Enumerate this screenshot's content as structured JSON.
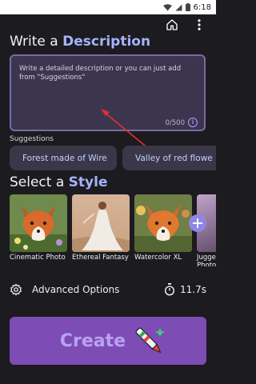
{
  "status_bar": {
    "time": "6:18"
  },
  "description_section": {
    "title_prefix": "Write a",
    "title_accent": "Description"
  },
  "description_input": {
    "placeholder": "Write a detailed description or you can just add from \"Suggestions\"",
    "counter": "0/500",
    "info_glyph": "i"
  },
  "suggestions": {
    "label": "Suggestions",
    "chips": [
      "Forest made of Wire",
      "Valley of red flowe"
    ]
  },
  "style_section": {
    "title_prefix": "Select a",
    "title_accent": "Style"
  },
  "styles": [
    {
      "label": "Cinematic Photo"
    },
    {
      "label": "Ethereal Fantasy"
    },
    {
      "label": "Watercolor XL"
    },
    {
      "label": "Jugge\nPhoto"
    }
  ],
  "advanced": {
    "label": "Advanced Options"
  },
  "timer": {
    "value": "11.7s"
  },
  "create": {
    "label": "Create"
  },
  "colors": {
    "background": "#1c1b1f",
    "accent_text": "#a6b2ff",
    "input_border": "#7a6aa3",
    "chip_bg": "#3a3748",
    "create_bg": "#7e4cb5",
    "annotation_arrow": "#e0322b"
  },
  "icons": [
    "wifi-icon",
    "signal-icon",
    "battery-icon",
    "home-icon",
    "more-vert-icon",
    "info-icon",
    "add-icon",
    "gear-icon",
    "timer-icon",
    "pen-icon"
  ]
}
